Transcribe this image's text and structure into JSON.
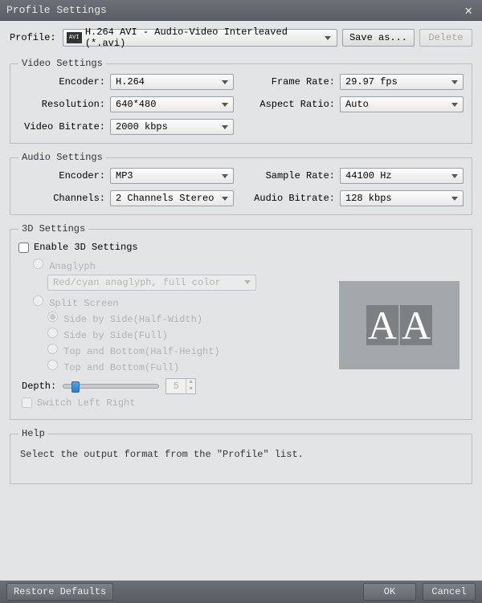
{
  "window": {
    "title": "Profile Settings"
  },
  "profile_row": {
    "label": "Profile:",
    "icon_text": "AVI",
    "value": "H.264 AVI - Audio-Video Interleaved (*.avi)",
    "save_as": "Save as...",
    "delete": "Delete"
  },
  "video": {
    "legend": "Video Settings",
    "encoder_label": "Encoder:",
    "encoder": "H.264",
    "frame_rate_label": "Frame Rate:",
    "frame_rate": "29.97 fps",
    "resolution_label": "Resolution:",
    "resolution": "640*480",
    "aspect_label": "Aspect Ratio:",
    "aspect": "Auto",
    "bitrate_label": "Video Bitrate:",
    "bitrate": "2000 kbps"
  },
  "audio": {
    "legend": "Audio Settings",
    "encoder_label": "Encoder:",
    "encoder": "MP3",
    "sample_label": "Sample Rate:",
    "sample": "44100 Hz",
    "channels_label": "Channels:",
    "channels": "2 Channels Stereo",
    "bitrate_label": "Audio Bitrate:",
    "bitrate": "128 kbps"
  },
  "threeD": {
    "legend": "3D Settings",
    "enable": "Enable 3D Settings",
    "anaglyph": "Anaglyph",
    "anaglyph_mode": "Red/cyan anaglyph, full color",
    "split": "Split Screen",
    "sbs_half": "Side by Side(Half-Width)",
    "sbs_full": "Side by Side(Full)",
    "tab_half": "Top and Bottom(Half-Height)",
    "tab_full": "Top and Bottom(Full)",
    "depth_label": "Depth:",
    "depth_value": "5",
    "switch": "Switch Left Right",
    "preview_a": "A",
    "preview_b": "A"
  },
  "help": {
    "legend": "Help",
    "text": "Select the output format from the \"Profile\" list."
  },
  "footer": {
    "restore": "Restore Defaults",
    "ok": "OK",
    "cancel": "Cancel"
  }
}
